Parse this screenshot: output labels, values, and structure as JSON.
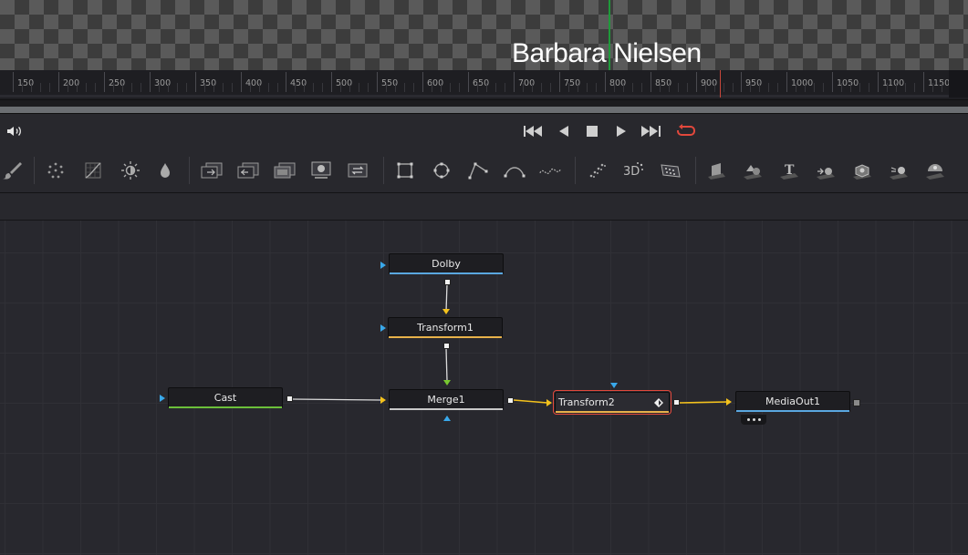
{
  "viewer": {
    "overlay_text": "Barbara Nielsen"
  },
  "ruler": {
    "ticks": [
      "150",
      "200",
      "250",
      "300",
      "350",
      "400",
      "450",
      "500",
      "550",
      "600",
      "650",
      "700",
      "750",
      "800",
      "850",
      "900",
      "950",
      "1000",
      "1050",
      "1100",
      "1150"
    ]
  },
  "transport": {
    "buttons": [
      "volume-icon",
      "skip-to-start-icon",
      "play-reverse-icon",
      "stop-icon",
      "play-forward-icon",
      "skip-to-end-icon",
      "loop-icon"
    ],
    "loop_color": "#e2483c"
  },
  "toolbar": {
    "tools": [
      "paint-brush-icon",
      "particles-icon",
      "color-curves-icon",
      "brightness-contrast-icon",
      "blur-drop-icon",
      "merge-icon",
      "channel-boolean-icon",
      "matte-control-icon",
      "media-in-icon",
      "transform-loop-icon",
      "rectangle-mask-icon",
      "ellipse-mask-icon",
      "polygon-mask-icon",
      "bspline-mask-icon",
      "wand-mask-icon",
      "particle-emitter-icon",
      "particle-render-icon",
      "particle-grid-icon",
      "shape3d-icon",
      "merge3d-icon",
      "text3d-icon",
      "camera3d-icon",
      "renderer3d-icon",
      "light3d-icon",
      "fbx-icon"
    ]
  },
  "nodes": {
    "dolby": {
      "label": "Dolby",
      "bar_color": "#5aa7e0"
    },
    "transform1": {
      "label": "Transform1",
      "bar_color": "#e8b24a"
    },
    "cast": {
      "label": "Cast",
      "bar_color": "#6bbf3a"
    },
    "merge1": {
      "label": "Merge1",
      "bar_color": "#c8c8c8"
    },
    "transform2": {
      "label": "Transform2",
      "bar_color": "#e8b24a",
      "selected": true
    },
    "mediaout1": {
      "label": "MediaOut1",
      "bar_color": "#5aa7e0"
    }
  },
  "colors": {
    "wire_yellow": "#f4c21c",
    "wire_white": "#dcdcdc",
    "port_blue": "#39a8ea",
    "playhead": "#c8473a"
  }
}
